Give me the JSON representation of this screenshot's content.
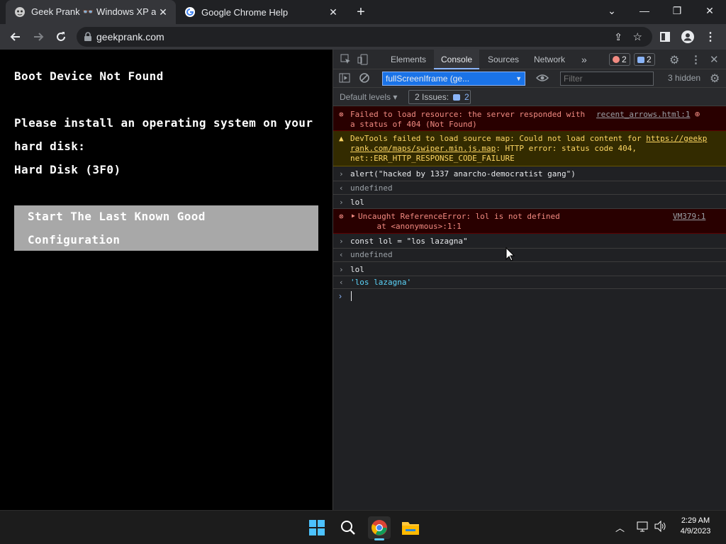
{
  "browser": {
    "tabs": [
      {
        "title": "Geek Prank 👓 Windows XP and",
        "close": "✕",
        "active": true
      },
      {
        "title": "Google Chrome Help",
        "close": "✕",
        "active": false
      }
    ],
    "new_tab": "+",
    "url": "geekprank.com"
  },
  "page": {
    "line1": "Boot Device Not Found",
    "line2": "Please install an operating system on your",
    "line3": "hard disk:",
    "line4": "Hard Disk (3F0)",
    "option1": "Start The Last Known Good",
    "option2": "Configuration"
  },
  "devtools": {
    "tabs": [
      "Elements",
      "Console",
      "Sources",
      "Network"
    ],
    "more": "»",
    "error_count": "2",
    "info_count": "2",
    "context": "fullScreenIframe (ge...",
    "filter_placeholder": "Filter",
    "hidden": "3 hidden",
    "default_levels": "Default levels ▾",
    "issues_label": "2 Issues:",
    "issues_count": "2",
    "console": [
      {
        "kind": "error",
        "text": "Failed to load resource: the server responded with\na status of 404 (Not Found)",
        "source": "recent_arrows.html:1"
      },
      {
        "kind": "warn",
        "text": "DevTools failed to load source map: Could not load content for ",
        "link": "https://geekp\nrank.com/maps/swiper.min.js.map",
        "rest": ": HTTP error: status code 404,\nnet::ERR_HTTP_RESPONSE_CODE_FAILURE"
      },
      {
        "kind": "cmd",
        "text": "alert(\"hacked by 1337 anarcho-democratist gang\")"
      },
      {
        "kind": "out",
        "text": "undefined"
      },
      {
        "kind": "cmd",
        "text": "lol"
      },
      {
        "kind": "error",
        "text": "Uncaught ReferenceError: lol is not defined\n    at <anonymous>:1:1",
        "source": "VM379:1"
      },
      {
        "kind": "cmd",
        "text": "const lol = \"los lazagna\""
      },
      {
        "kind": "out",
        "text": "undefined"
      },
      {
        "kind": "cmd",
        "text": "lol"
      },
      {
        "kind": "out-str",
        "text": "'los lazagna'"
      }
    ]
  },
  "taskbar": {
    "time": "2:29 AM",
    "date": "4/9/2023"
  },
  "colors": {
    "accent": "#8ab4f8",
    "error_bg": "#290000",
    "warn_bg": "#332b00"
  }
}
